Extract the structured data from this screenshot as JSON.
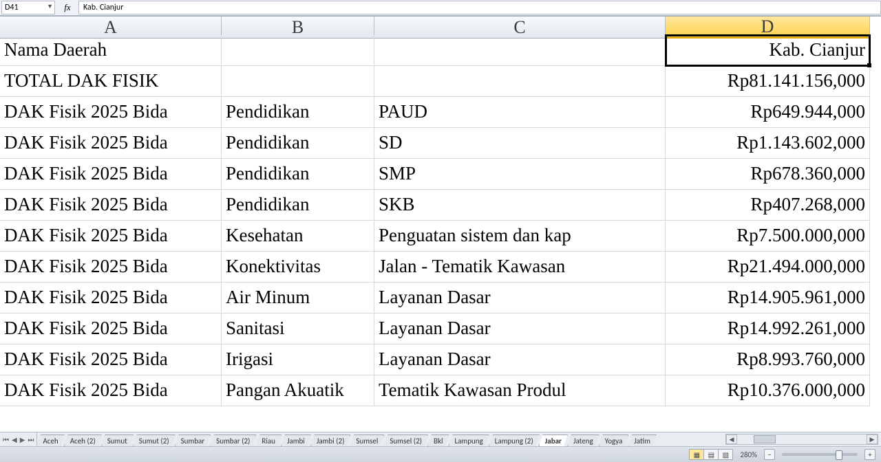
{
  "namebox_ref": "D41",
  "formula_value": "Kab. Cianjur",
  "columns": [
    "A",
    "B",
    "C",
    "D"
  ],
  "selected_col_index": 3,
  "rows": [
    {
      "a": "Nama Daerah",
      "b": "",
      "c": "",
      "d": "Kab. Cianjur"
    },
    {
      "a": "TOTAL DAK FISIK",
      "b": "",
      "c": "",
      "d": "Rp81.141.156,000"
    },
    {
      "a": "DAK Fisik 2025 Bida",
      "b": "Pendidikan",
      "c": "PAUD",
      "d": "Rp649.944,000"
    },
    {
      "a": "DAK Fisik 2025 Bida",
      "b": "Pendidikan",
      "c": "SD",
      "d": "Rp1.143.602,000"
    },
    {
      "a": "DAK Fisik 2025 Bida",
      "b": "Pendidikan",
      "c": "SMP",
      "d": "Rp678.360,000"
    },
    {
      "a": "DAK Fisik 2025 Bida",
      "b": "Pendidikan",
      "c": "SKB",
      "d": "Rp407.268,000"
    },
    {
      "a": "DAK Fisik 2025 Bida",
      "b": "Kesehatan",
      "c": "Penguatan sistem dan kap",
      "d": "Rp7.500.000,000"
    },
    {
      "a": "DAK Fisik 2025 Bida",
      "b": "Konektivitas",
      "c": "Jalan - Tematik Kawasan",
      "d": "Rp21.494.000,000"
    },
    {
      "a": "DAK Fisik 2025 Bida",
      "b": "Air Minum",
      "c": "Layanan Dasar",
      "d": "Rp14.905.961,000"
    },
    {
      "a": "DAK Fisik 2025 Bida",
      "b": "Sanitasi",
      "c": "Layanan Dasar",
      "d": "Rp14.992.261,000"
    },
    {
      "a": "DAK Fisik 2025 Bida",
      "b": "Irigasi",
      "c": "Layanan Dasar",
      "d": "Rp8.993.760,000"
    },
    {
      "a": "DAK Fisik 2025 Bida",
      "b": "Pangan Akuatik",
      "c": "Tematik Kawasan Produl",
      "d": "Rp10.376.000,000"
    }
  ],
  "sheet_tabs": [
    "Aceh",
    "Aceh (2)",
    "Sumut",
    "Sumut (2)",
    "Sumbar",
    "Sumbar (2)",
    "Riau",
    "Jambi",
    "Jambi (2)",
    "Sumsel",
    "Sumsel (2)",
    "Bkl",
    "Lampung",
    "Lampung (2)",
    "Jabar",
    "Jateng",
    "Yogya",
    "Jatim"
  ],
  "active_tab": "Jabar",
  "zoom_label": "280%",
  "tabnav_glyphs": {
    "first": "⏮",
    "prev": "◀",
    "next": "▶",
    "last": "⏭"
  },
  "view_glyphs": {
    "normal": "▦",
    "layout": "▤",
    "break": "▧"
  },
  "zoom_minus": "−",
  "zoom_plus": "+"
}
